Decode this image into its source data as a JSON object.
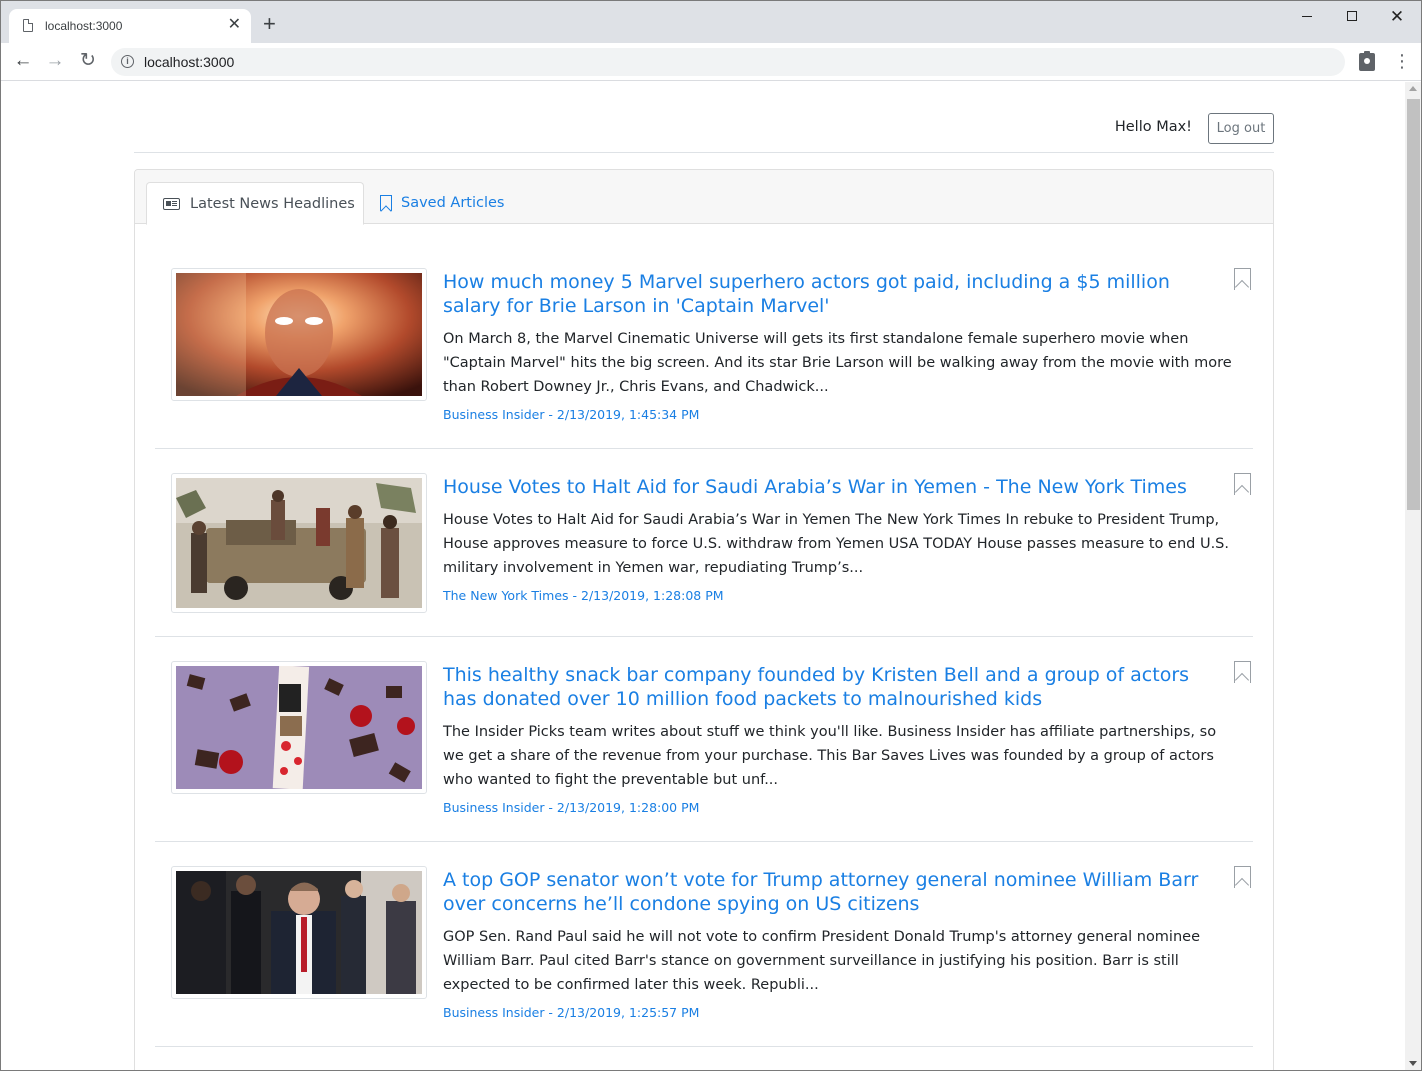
{
  "browser": {
    "tab_title": "localhost:3000",
    "new_tab_label": "+",
    "url": "localhost:3000"
  },
  "header": {
    "greeting": "Hello Max!",
    "logout_label": "Log out"
  },
  "tabs": {
    "latest": "Latest News Headlines",
    "saved": "Saved Articles"
  },
  "colors": {
    "link": "#1a7fe3",
    "text": "#212529",
    "muted": "#495057"
  },
  "articles": [
    {
      "title": "How much money 5 Marvel superhero actors got paid, including a $5 million salary for Brie Larson in 'Captain Marvel'",
      "description": "On March 8, the Marvel Cinematic Universe will gets its first standalone female superhero movie when \"Captain Marvel\" hits the big screen. And its star Brie Larson will be walking away from the movie with more than Robert Downey Jr., Chris Evans, and Chadwick...",
      "meta": "Business Insider - 2/13/2019, 1:45:34 PM"
    },
    {
      "title": "House Votes to Halt Aid for Saudi Arabia’s War in Yemen - The New York Times",
      "description": "House Votes to Halt Aid for Saudi Arabia’s War in Yemen The New York Times In rebuke to President Trump, House approves measure to force U.S. withdraw from Yemen USA TODAY House passes measure to end U.S. military involvement in Yemen war, repudiating Trump’s...",
      "meta": "The New York Times - 2/13/2019, 1:28:08 PM"
    },
    {
      "title": "This healthy snack bar company founded by Kristen Bell and a group of actors has donated over 10 million food packets to malnourished kids",
      "description": "The Insider Picks team writes about stuff we think you'll like. Business Insider has affiliate partnerships, so we get a share of the revenue from your purchase. This Bar Saves Lives was founded by a group of actors who wanted to fight the preventable but unf...",
      "meta": "Business Insider - 2/13/2019, 1:28:00 PM"
    },
    {
      "title": "A top GOP senator won’t vote for Trump attorney general nominee William Barr over concerns he’ll condone spying on US citizens",
      "description": "GOP Sen. Rand Paul said he will not vote to confirm President Donald Trump's attorney general nominee William Barr. Paul cited Barr's stance on government surveillance in justifying his position. Barr is still expected to be confirmed later this week. Republi...",
      "meta": "Business Insider - 2/13/2019, 1:25:57 PM"
    }
  ]
}
